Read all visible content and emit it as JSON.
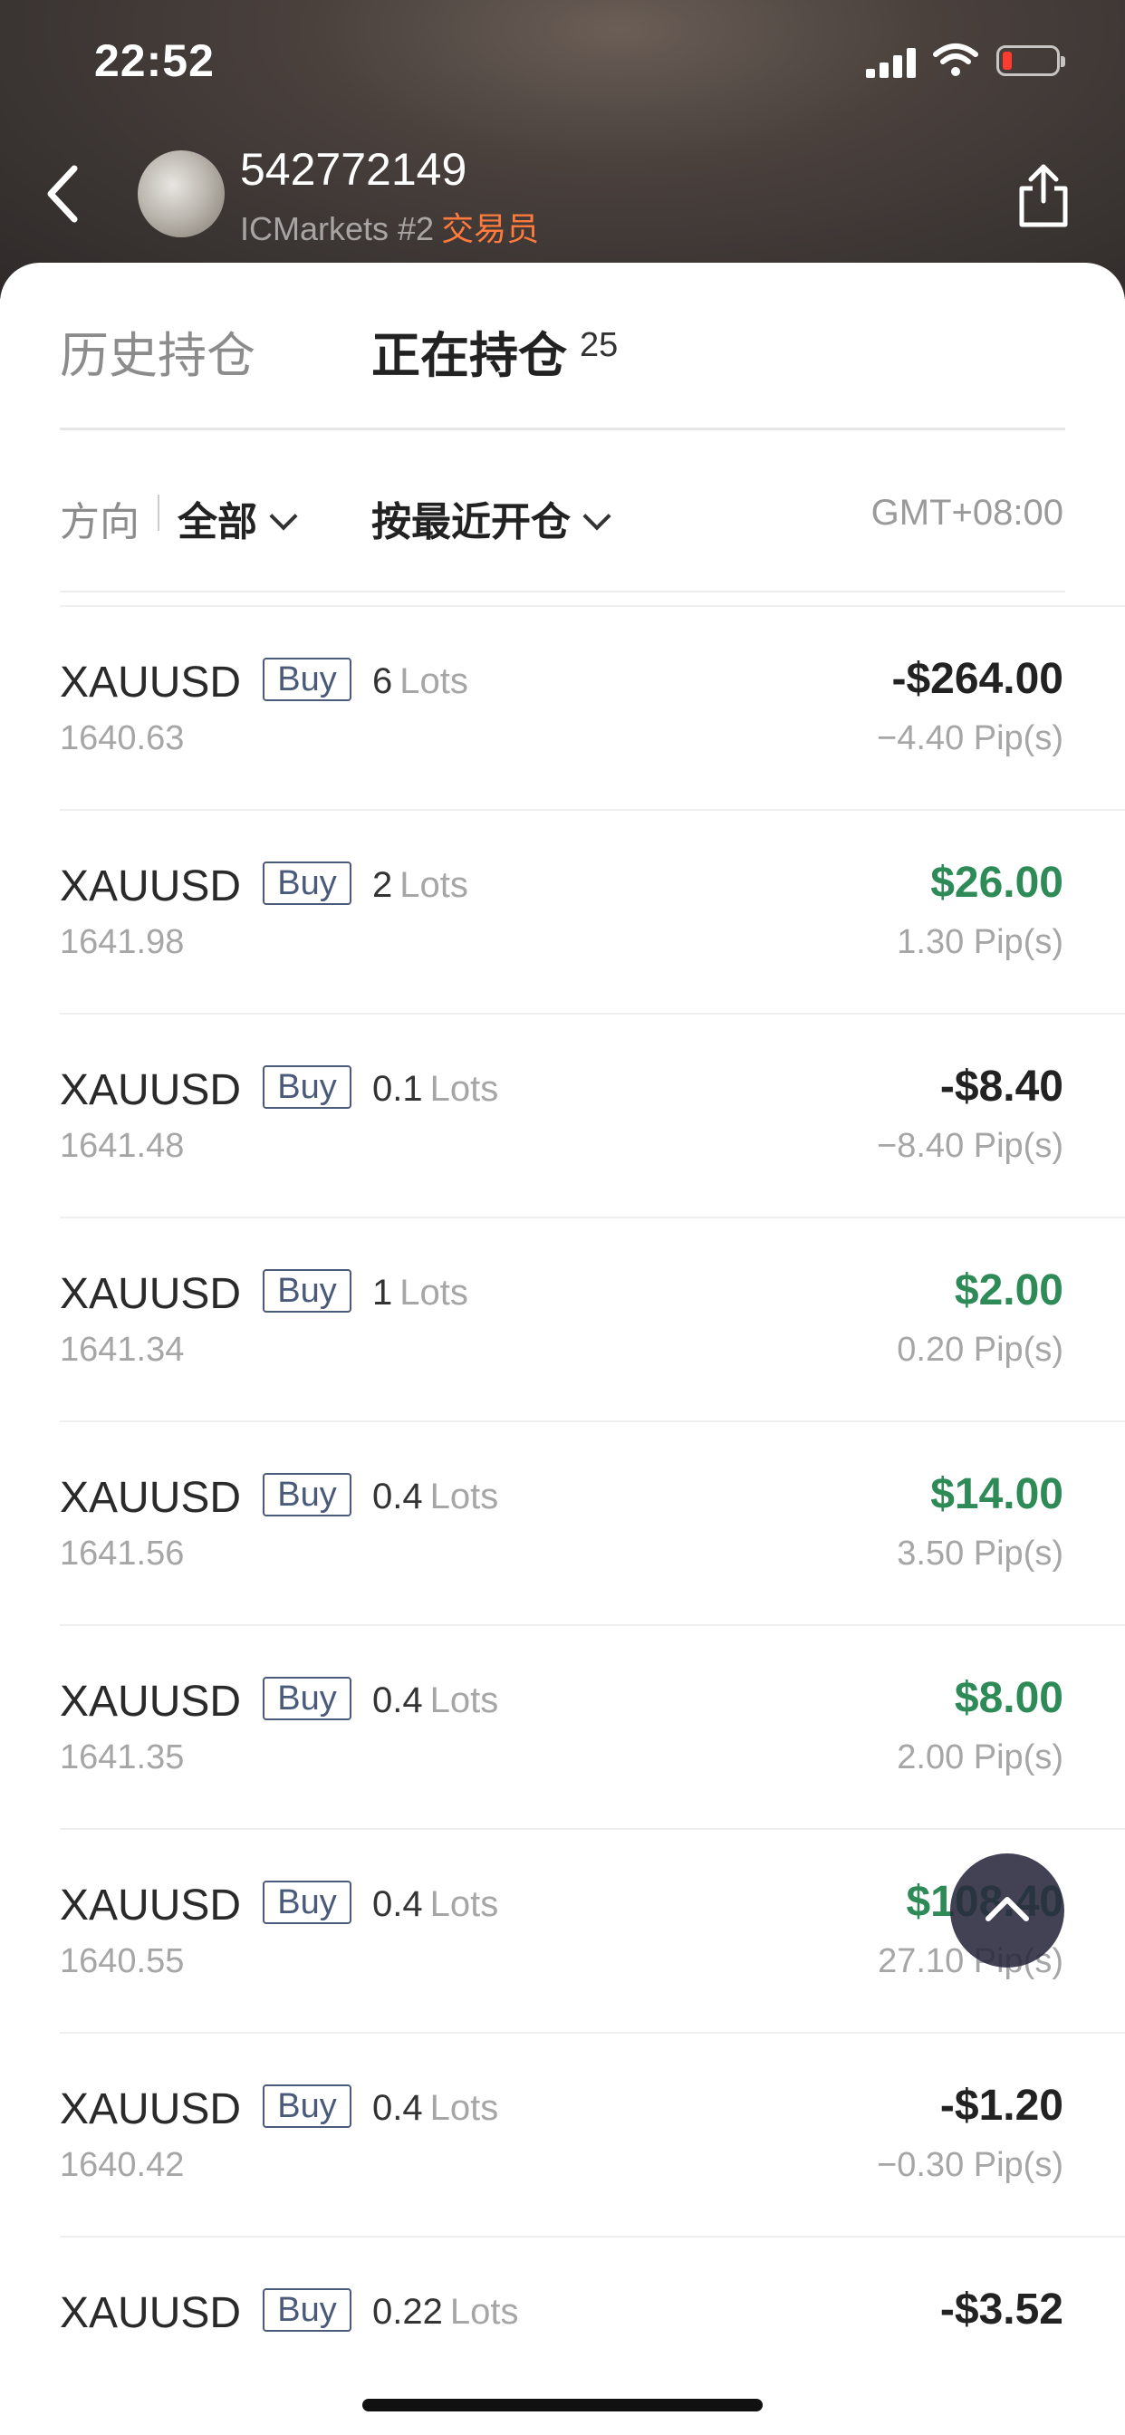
{
  "status_bar": {
    "time": "22:52"
  },
  "header": {
    "user_id": "542772149",
    "broker": "ICMarkets #2",
    "role": "交易员"
  },
  "tabs": [
    {
      "label": "历史持仓",
      "active": false
    },
    {
      "label": "正在持仓",
      "active": true,
      "count": "25"
    }
  ],
  "filters": {
    "direction_label": "方向",
    "direction_value": "全部",
    "sort_value": "按最近开仓",
    "timezone": "GMT+08:00"
  },
  "colors": {
    "profit": "#2e8b57",
    "loss": "#222222",
    "role": "#ff7a3c"
  },
  "positions": [
    {
      "symbol": "XAUUSD",
      "side": "Buy",
      "lots": "6",
      "lots_unit": "Lots",
      "open_price": "1640.63",
      "pnl": "-$264.00",
      "pips": "−4.40 Pip(s)",
      "positive": false
    },
    {
      "symbol": "XAUUSD",
      "side": "Buy",
      "lots": "2",
      "lots_unit": "Lots",
      "open_price": "1641.98",
      "pnl": "$26.00",
      "pips": "1.30 Pip(s)",
      "positive": true
    },
    {
      "symbol": "XAUUSD",
      "side": "Buy",
      "lots": "0.1",
      "lots_unit": "Lots",
      "open_price": "1641.48",
      "pnl": "-$8.40",
      "pips": "−8.40 Pip(s)",
      "positive": false
    },
    {
      "symbol": "XAUUSD",
      "side": "Buy",
      "lots": "1",
      "lots_unit": "Lots",
      "open_price": "1641.34",
      "pnl": "$2.00",
      "pips": "0.20 Pip(s)",
      "positive": true
    },
    {
      "symbol": "XAUUSD",
      "side": "Buy",
      "lots": "0.4",
      "lots_unit": "Lots",
      "open_price": "1641.56",
      "pnl": "$14.00",
      "pips": "3.50 Pip(s)",
      "positive": true
    },
    {
      "symbol": "XAUUSD",
      "side": "Buy",
      "lots": "0.4",
      "lots_unit": "Lots",
      "open_price": "1641.35",
      "pnl": "$8.00",
      "pips": "2.00 Pip(s)",
      "positive": true
    },
    {
      "symbol": "XAUUSD",
      "side": "Buy",
      "lots": "0.4",
      "lots_unit": "Lots",
      "open_price": "1640.55",
      "pnl": "$108.40",
      "pips": "27.10 Pip(s)",
      "positive": true
    },
    {
      "symbol": "XAUUSD",
      "side": "Buy",
      "lots": "0.4",
      "lots_unit": "Lots",
      "open_price": "1640.42",
      "pnl": "-$1.20",
      "pips": "−0.30 Pip(s)",
      "positive": false
    },
    {
      "symbol": "XAUUSD",
      "side": "Buy",
      "lots": "0.22",
      "lots_unit": "Lots",
      "open_price": "",
      "pnl": "-$3.52",
      "pips": "",
      "positive": false
    }
  ]
}
